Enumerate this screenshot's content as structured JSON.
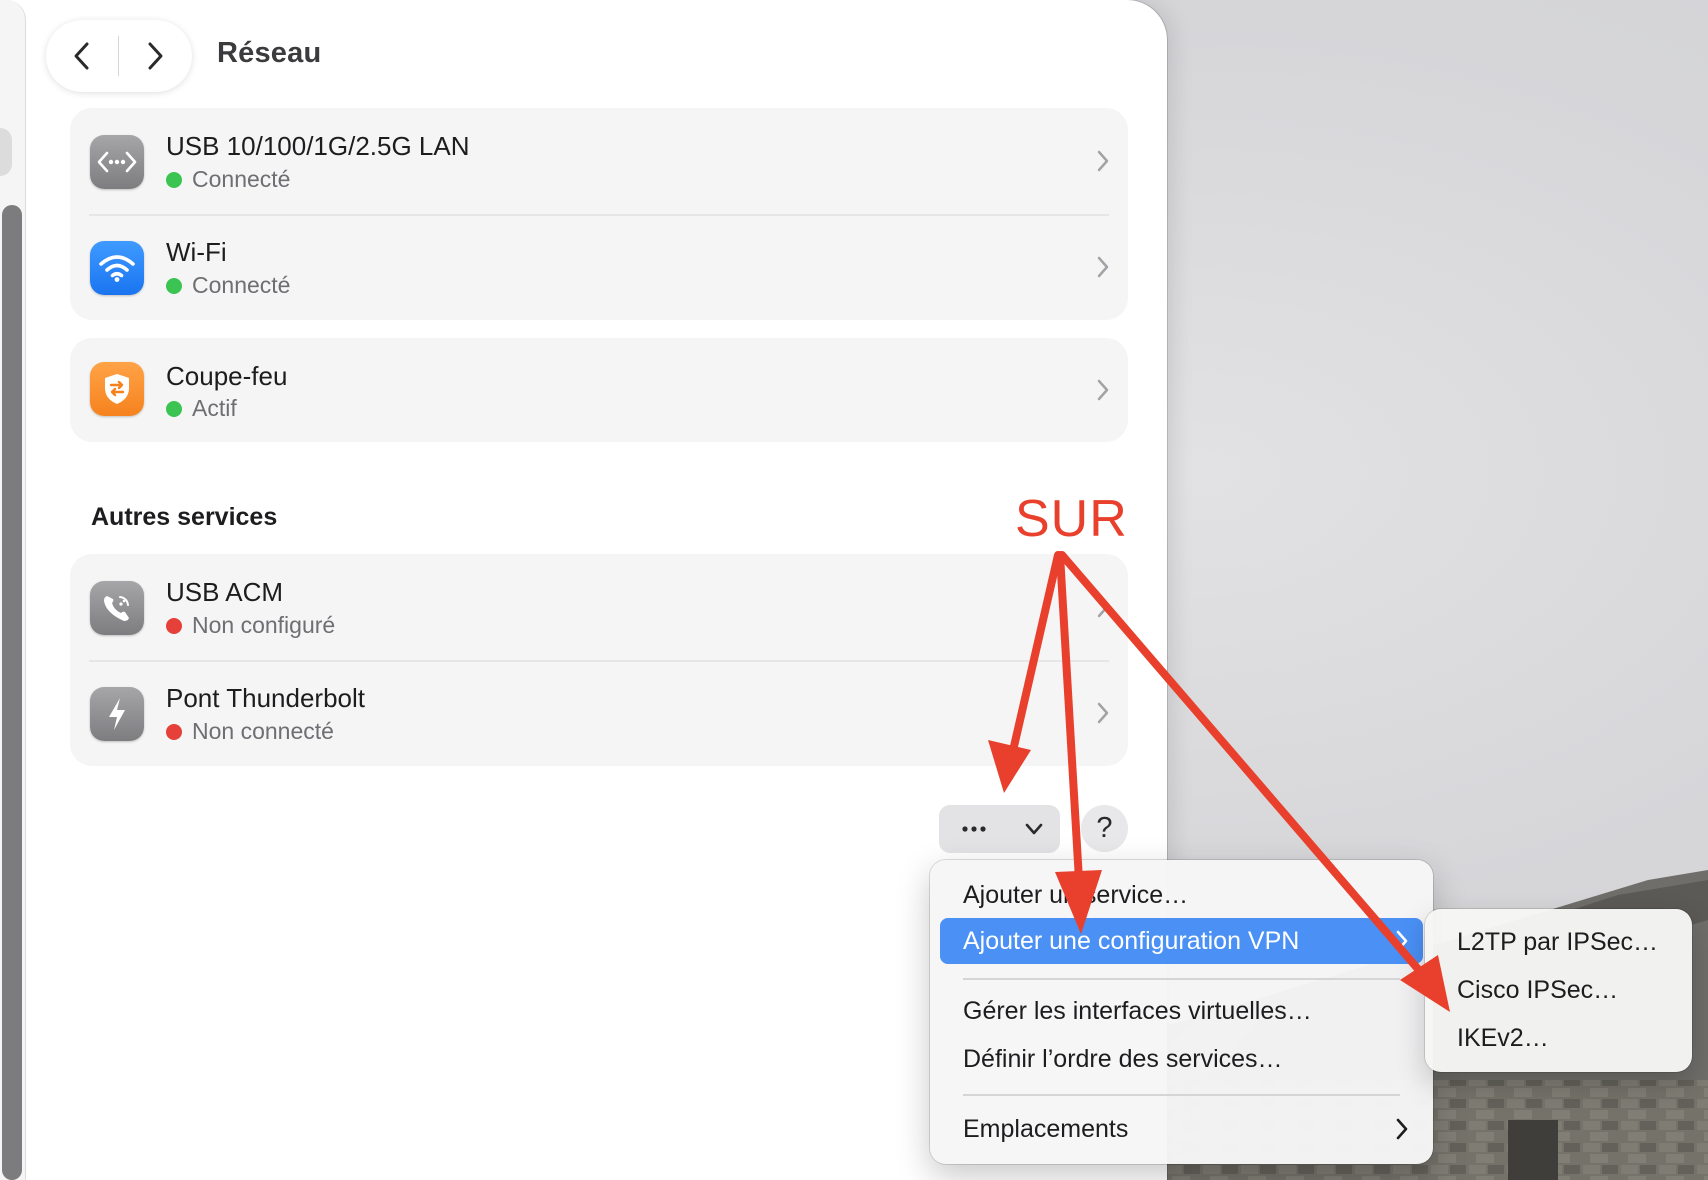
{
  "window": {
    "title": "Réseau"
  },
  "services": [
    {
      "title": "USB 10/100/1G/2.5G LAN",
      "status": "Connecté",
      "status_color": "#3cc453",
      "icon": "ethernet-icon"
    },
    {
      "title": "Wi-Fi",
      "status": "Connecté",
      "status_color": "#3cc453",
      "icon": "wifi-icon"
    }
  ],
  "firewall": {
    "title": "Coupe-feu",
    "status": "Actif",
    "status_color": "#3cc453",
    "icon": "firewall-shield-icon"
  },
  "other_services": {
    "title": "Autres services",
    "items": [
      {
        "title": "USB ACM",
        "status": "Non configuré",
        "status_color": "#e5403a",
        "icon": "phone-icon"
      },
      {
        "title": "Pont Thunderbolt",
        "status": "Non connecté",
        "status_color": "#e5403a",
        "icon": "thunderbolt-icon"
      }
    ]
  },
  "buttons": {
    "action_icon": "ellipsis-icon",
    "help_label": "?"
  },
  "context_menu": {
    "items": [
      {
        "label": "Ajouter un service…"
      },
      {
        "label": "Ajouter une configuration VPN",
        "selected": true,
        "has_submenu": true
      },
      {
        "label": "Gérer les interfaces virtuelles…"
      },
      {
        "label": "Définir l’ordre des services…"
      },
      {
        "label": "Emplacements",
        "has_submenu": true
      }
    ]
  },
  "vpn_submenu": {
    "items": [
      {
        "label": "L2TP par IPSec…"
      },
      {
        "label": "Cisco IPSec…"
      },
      {
        "label": "IKEv2…"
      }
    ]
  },
  "annotation": {
    "label": "SUR",
    "color": "#e8402c"
  },
  "colors": {
    "accent": "#4a90f5",
    "connected": "#3cc453",
    "disconnected": "#e5403a"
  }
}
